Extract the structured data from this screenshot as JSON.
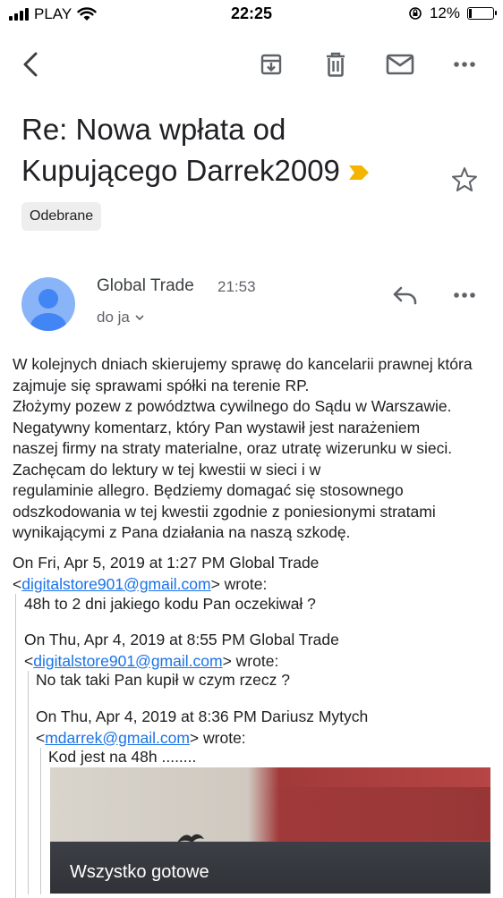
{
  "status_bar": {
    "carrier": "PLAY",
    "time": "22:25",
    "battery_percent": "12%",
    "battery_level": 0.12
  },
  "toolbar": {
    "icons": [
      "back-arrow-icon",
      "archive-icon",
      "trash-icon",
      "mail-icon",
      "more-icon"
    ]
  },
  "email": {
    "subject": "Re: Nowa wpłata od Kupującego Darrek2009",
    "label_chip": "Odebrane",
    "sender_name": "Global Trade",
    "time": "21:53",
    "recipient": "do ja",
    "body_lines": [
      "W kolejnych dniach skierujemy sprawę do kancelarii prawnej która",
      "zajmuje się sprawami spółki na terenie RP.",
      "Złożymy pozew z powództwa cywilnego do Sądu w Warszawie.",
      "Negatywny komentarz, który Pan wystawił jest narażeniem",
      "naszej firmy na straty materialne, oraz utratę wizerunku w sieci.",
      "Zachęcam do lektury w tej kwestii w sieci i w",
      "regulaminie allegro.  Będziemy domagać się stosownego",
      "odszkodowania w tej kwestii zgodnie z poniesionymi stratami",
      "wynikającymi z Pana działania na naszą szkodę."
    ],
    "quotes": [
      {
        "header_line1": "On Fri, Apr 5, 2019 at 1:27 PM Global Trade",
        "email": "digitalstore901@gmail.com",
        "wrote": "wrote:",
        "text": "48h to 2 dni jakiego kodu Pan oczekiwał ?"
      },
      {
        "header_line1": "On Thu, Apr 4, 2019 at 8:55 PM Global Trade",
        "email": "digitalstore901@gmail.com",
        "wrote": "wrote:",
        "text": "No tak taki Pan kupił w czym rzecz ?"
      },
      {
        "header_line1": "On Thu, Apr 4, 2019 at 8:36 PM Dariusz Mytych",
        "email": "mdarrek@gmail.com",
        "wrote": "wrote:",
        "text": "Kod jest na 48h ........"
      }
    ],
    "attachment_caption": "Wszystko gotowe"
  },
  "colors": {
    "link": "#1a73e8",
    "label_arrow": "#f4b400",
    "avatar": "#8ab4f8",
    "avatar_figure": "#4285f4"
  }
}
